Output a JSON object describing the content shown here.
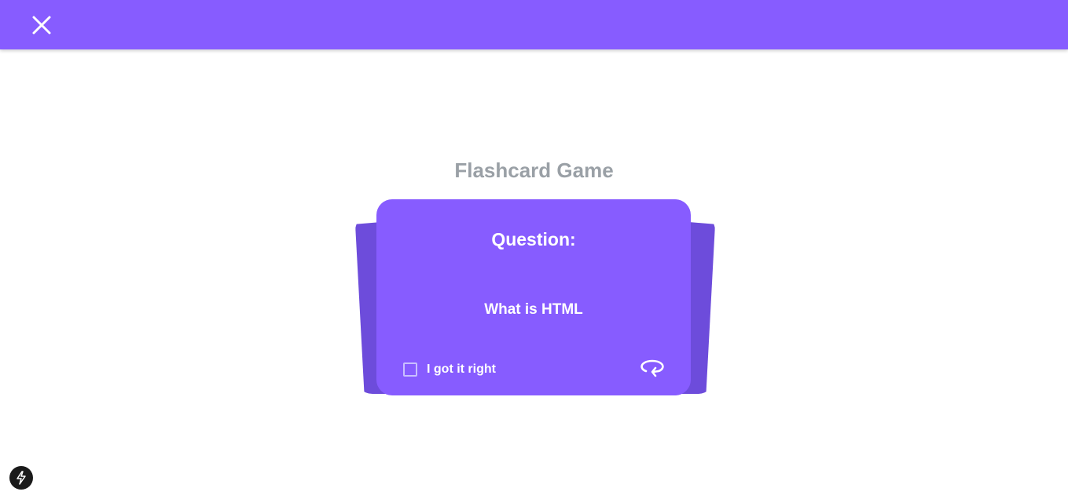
{
  "header": {
    "close_icon": "close-icon",
    "bar_color": "#875cff"
  },
  "main": {
    "title": "Flashcard Game"
  },
  "card": {
    "heading": "Question:",
    "question": "What is HTML",
    "checkbox_label": "I got it right",
    "checkbox_checked": false,
    "flip_icon": "flip-icon",
    "card_color": "#875cff",
    "back_card_color": "#6d4cdb"
  },
  "fab": {
    "icon": "lightning-icon"
  }
}
